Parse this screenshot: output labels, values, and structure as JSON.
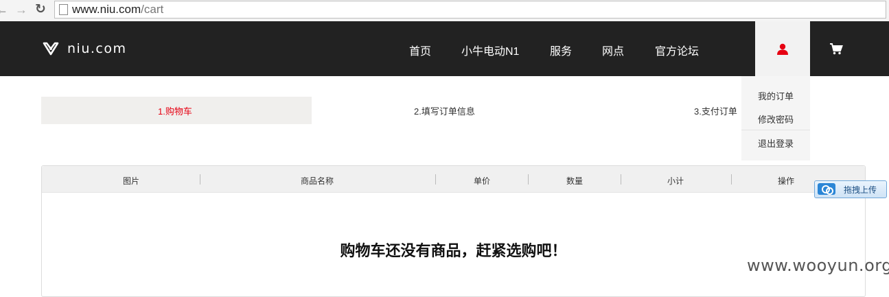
{
  "browser": {
    "url_host": "www.niu.com",
    "url_path": "/cart",
    "icons": [
      "back-icon",
      "forward-icon",
      "reload-icon",
      "page-icon"
    ]
  },
  "header": {
    "logo_text": "niu.com",
    "nav": [
      "首页",
      "小牛电动N1",
      "服务",
      "网点",
      "官方论坛"
    ],
    "user_icon_color": "#e60012",
    "background_color": "#222222"
  },
  "user_menu": {
    "items": [
      "我的订单",
      "修改密码",
      "退出登录"
    ]
  },
  "steps": {
    "items": [
      "1.购物车",
      "2.填写订单信息",
      "3.支付订单"
    ],
    "active_index": 0,
    "active_color": "#e60012"
  },
  "cart": {
    "columns": [
      "图片",
      "商品名称",
      "单价",
      "数量",
      "小计",
      "操作"
    ],
    "empty_message": "购物车还没有商品，赶紧选购吧！"
  },
  "upload_widget": {
    "label": "拖拽上传"
  },
  "watermark": "www.wooyun.org"
}
